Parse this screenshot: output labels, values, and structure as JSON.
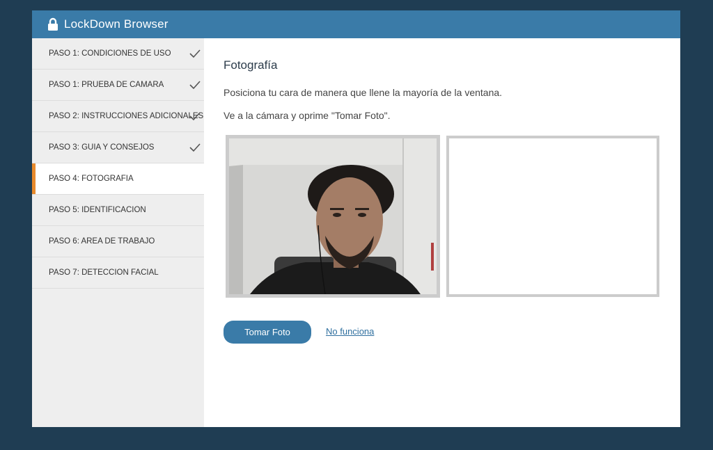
{
  "app": {
    "title": "LockDown Browser"
  },
  "sidebar": {
    "steps": [
      {
        "label": "PASO 1: CONDICIONES DE USO",
        "completed": true
      },
      {
        "label": "PASO 1: PRUEBA DE CAMARA",
        "completed": true
      },
      {
        "label": "PASO 2: INSTRUCCIONES ADICIONALES",
        "completed": true
      },
      {
        "label": "PASO 3: GUIA Y CONSEJOS",
        "completed": true
      },
      {
        "label": "PASO 4: FOTOGRAFIA",
        "completed": false,
        "active": true
      },
      {
        "label": "PASO 5: IDENTIFICACION",
        "completed": false
      },
      {
        "label": "PASO 6: AREA DE TRABAJO",
        "completed": false
      },
      {
        "label": "PASO 7: DETECCION FACIAL",
        "completed": false
      }
    ]
  },
  "main": {
    "heading": "Fotografía",
    "instruction_1": "Posiciona tu cara de manera que llene la mayoría de la ventana.",
    "instruction_2": "Ve a la cámara y oprime \"Tomar Foto\".",
    "take_photo_label": "Tomar Foto",
    "not_working_label": "No funciona"
  },
  "colors": {
    "titlebar": "#3a7ba8",
    "background": "#1f3d53",
    "active_indicator": "#e88a2c",
    "button": "#3a7ba8"
  }
}
